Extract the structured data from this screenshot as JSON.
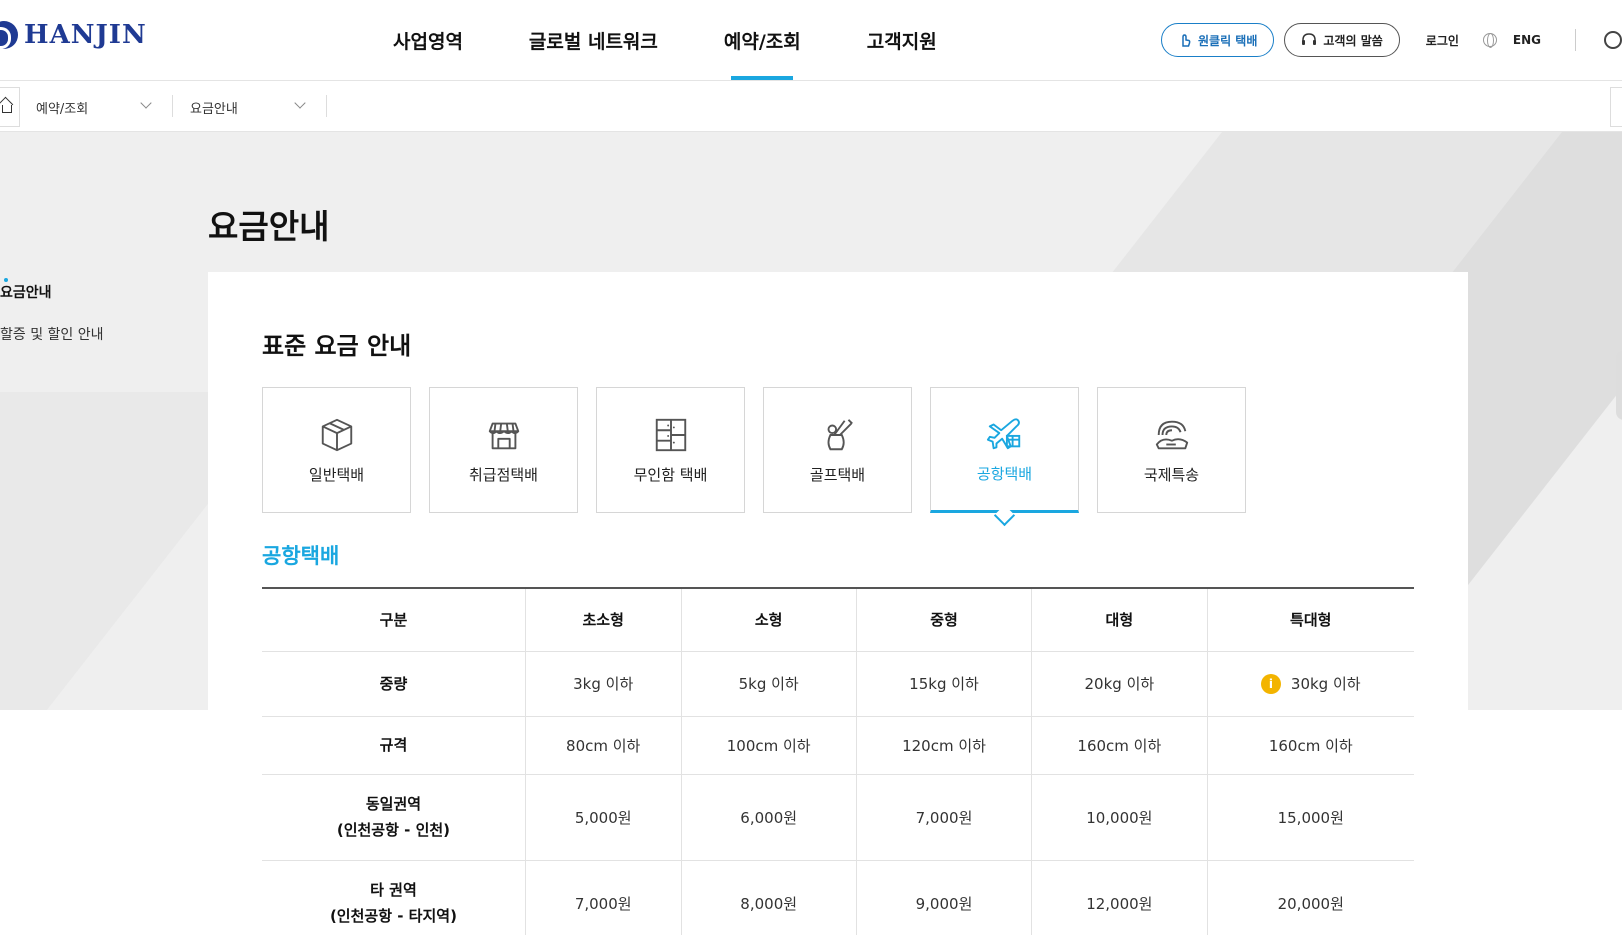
{
  "header": {
    "logo_text": "HANJIN",
    "nav": [
      "사업영역",
      "글로벌 네트워크",
      "예약/조회",
      "고객지원"
    ],
    "active_nav_index": 2,
    "one_click_label": "원클릭 택배",
    "voice_label": "고객의 말씀",
    "login_label": "로그인",
    "lang_label": "ENG"
  },
  "breadcrumb": {
    "level1": "예약/조회",
    "level2": "요금안내"
  },
  "page": {
    "title": "요금안내"
  },
  "lnb": {
    "items": [
      "요금안내",
      "할증 및 할인 안내"
    ],
    "active_index": 0
  },
  "section": {
    "title": "표준 요금 안내",
    "sub_title": "공항택배"
  },
  "service_tabs": [
    {
      "label": "일반택배",
      "icon": "box-icon"
    },
    {
      "label": "취급점택배",
      "icon": "store-icon"
    },
    {
      "label": "무인함 택배",
      "icon": "locker-icon"
    },
    {
      "label": "골프택배",
      "icon": "golf-icon"
    },
    {
      "label": "공항택배",
      "icon": "airplane-icon"
    },
    {
      "label": "국제특송",
      "icon": "global-delivery-icon"
    }
  ],
  "active_service_index": 4,
  "table": {
    "headers": [
      "구분",
      "초소형",
      "소형",
      "중형",
      "대형",
      "특대형"
    ],
    "rows": [
      {
        "label": "중량",
        "cells": [
          "3kg 이하",
          "5kg 이하",
          "15kg 이하",
          "20kg 이하",
          "30kg 이하"
        ]
      },
      {
        "label": "규격",
        "cells": [
          "80cm 이하",
          "100cm 이하",
          "120cm 이하",
          "160cm 이하",
          "160cm 이하"
        ]
      },
      {
        "label_line1": "동일권역",
        "label_line2": "(인천공항 - 인천)",
        "cells": [
          "5,000원",
          "6,000원",
          "7,000원",
          "10,000원",
          "15,000원"
        ]
      },
      {
        "label_line1": "타 권역",
        "label_line2": "(인천공항 - 타지역)",
        "cells": [
          "7,000원",
          "8,000원",
          "9,000원",
          "12,000원",
          "20,000원"
        ]
      }
    ],
    "info_badge": "i"
  },
  "colors": {
    "accent": "#1aa7e0",
    "brand": "#1f3a93",
    "info": "#f3b400"
  }
}
